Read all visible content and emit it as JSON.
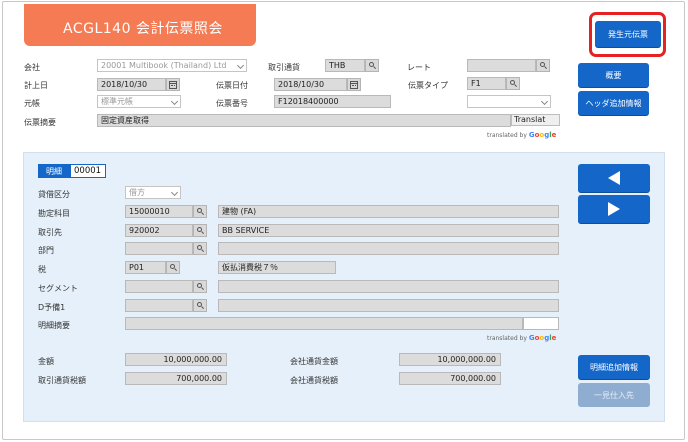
{
  "header": {
    "title": "ACGL140 会計伝票照会",
    "source_slip_button": "発生元伝票"
  },
  "side_buttons": {
    "overview": "概要",
    "header_extra": "ヘッダ追加情報",
    "detail_extra": "明細追加情報",
    "vendor": "一見仕入先"
  },
  "header_form": {
    "company_label": "会社",
    "company_value": "20001 Multibook (Thailand) Ltd",
    "currency_label": "取引通貨",
    "currency_value": "THB",
    "rate_label": "レート",
    "rate_value": "",
    "posting_date_label": "計上日",
    "posting_date_value": "2018/10/30",
    "slip_date_label": "伝票日付",
    "slip_date_value": "2018/10/30",
    "slip_type_label": "伝票タイプ",
    "slip_type_value": "F1",
    "ledger_label": "元帳",
    "ledger_value": "標準元帳",
    "slip_no_label": "伝票番号",
    "slip_no_value": "F12018400000",
    "summary_label": "伝票摘要",
    "summary_value": "固定資産取得",
    "translate_button": "Translat",
    "translated_by": "translated by"
  },
  "detail": {
    "tab_label": "明細",
    "line_no": "00001",
    "dc_label": "貸借区分",
    "dc_value": "借方",
    "account_label": "勘定科目",
    "account_code": "15000010",
    "account_name": "建物 (FA)",
    "partner_label": "取引先",
    "partner_code": "920002",
    "partner_name": "BB SERVICE",
    "dept_label": "部門",
    "dept_code": "",
    "dept_name": "",
    "tax_label": "税",
    "tax_code": "P01",
    "tax_name": "仮払消費税７％",
    "segment_label": "セグメント",
    "segment_code": "",
    "segment_name": "",
    "d_reserve_label": "D予備1",
    "d_reserve_code": "",
    "d_reserve_name": "",
    "memo_label": "明細摘要",
    "memo_value": "",
    "translated_by": "translated by",
    "amount_label": "金額",
    "amount_value": "10,000,000.00",
    "company_amount_label": "会社通貨金額",
    "company_amount_value": "10,000,000.00",
    "tax_amount_label": "取引通貨税額",
    "tax_amount_value": "700,000.00",
    "company_tax_label": "会社通貨税額",
    "company_tax_value": "700,000.00"
  },
  "google": {
    "g1": "G",
    "o1": "o",
    "o2": "o",
    "g2": "g",
    "l": "l",
    "e": "e"
  },
  "colors": {
    "banner": "#f47b53",
    "primary_button": "#1467c8",
    "highlight_box": "#e52121",
    "detail_panel": "#e6f0fa"
  }
}
